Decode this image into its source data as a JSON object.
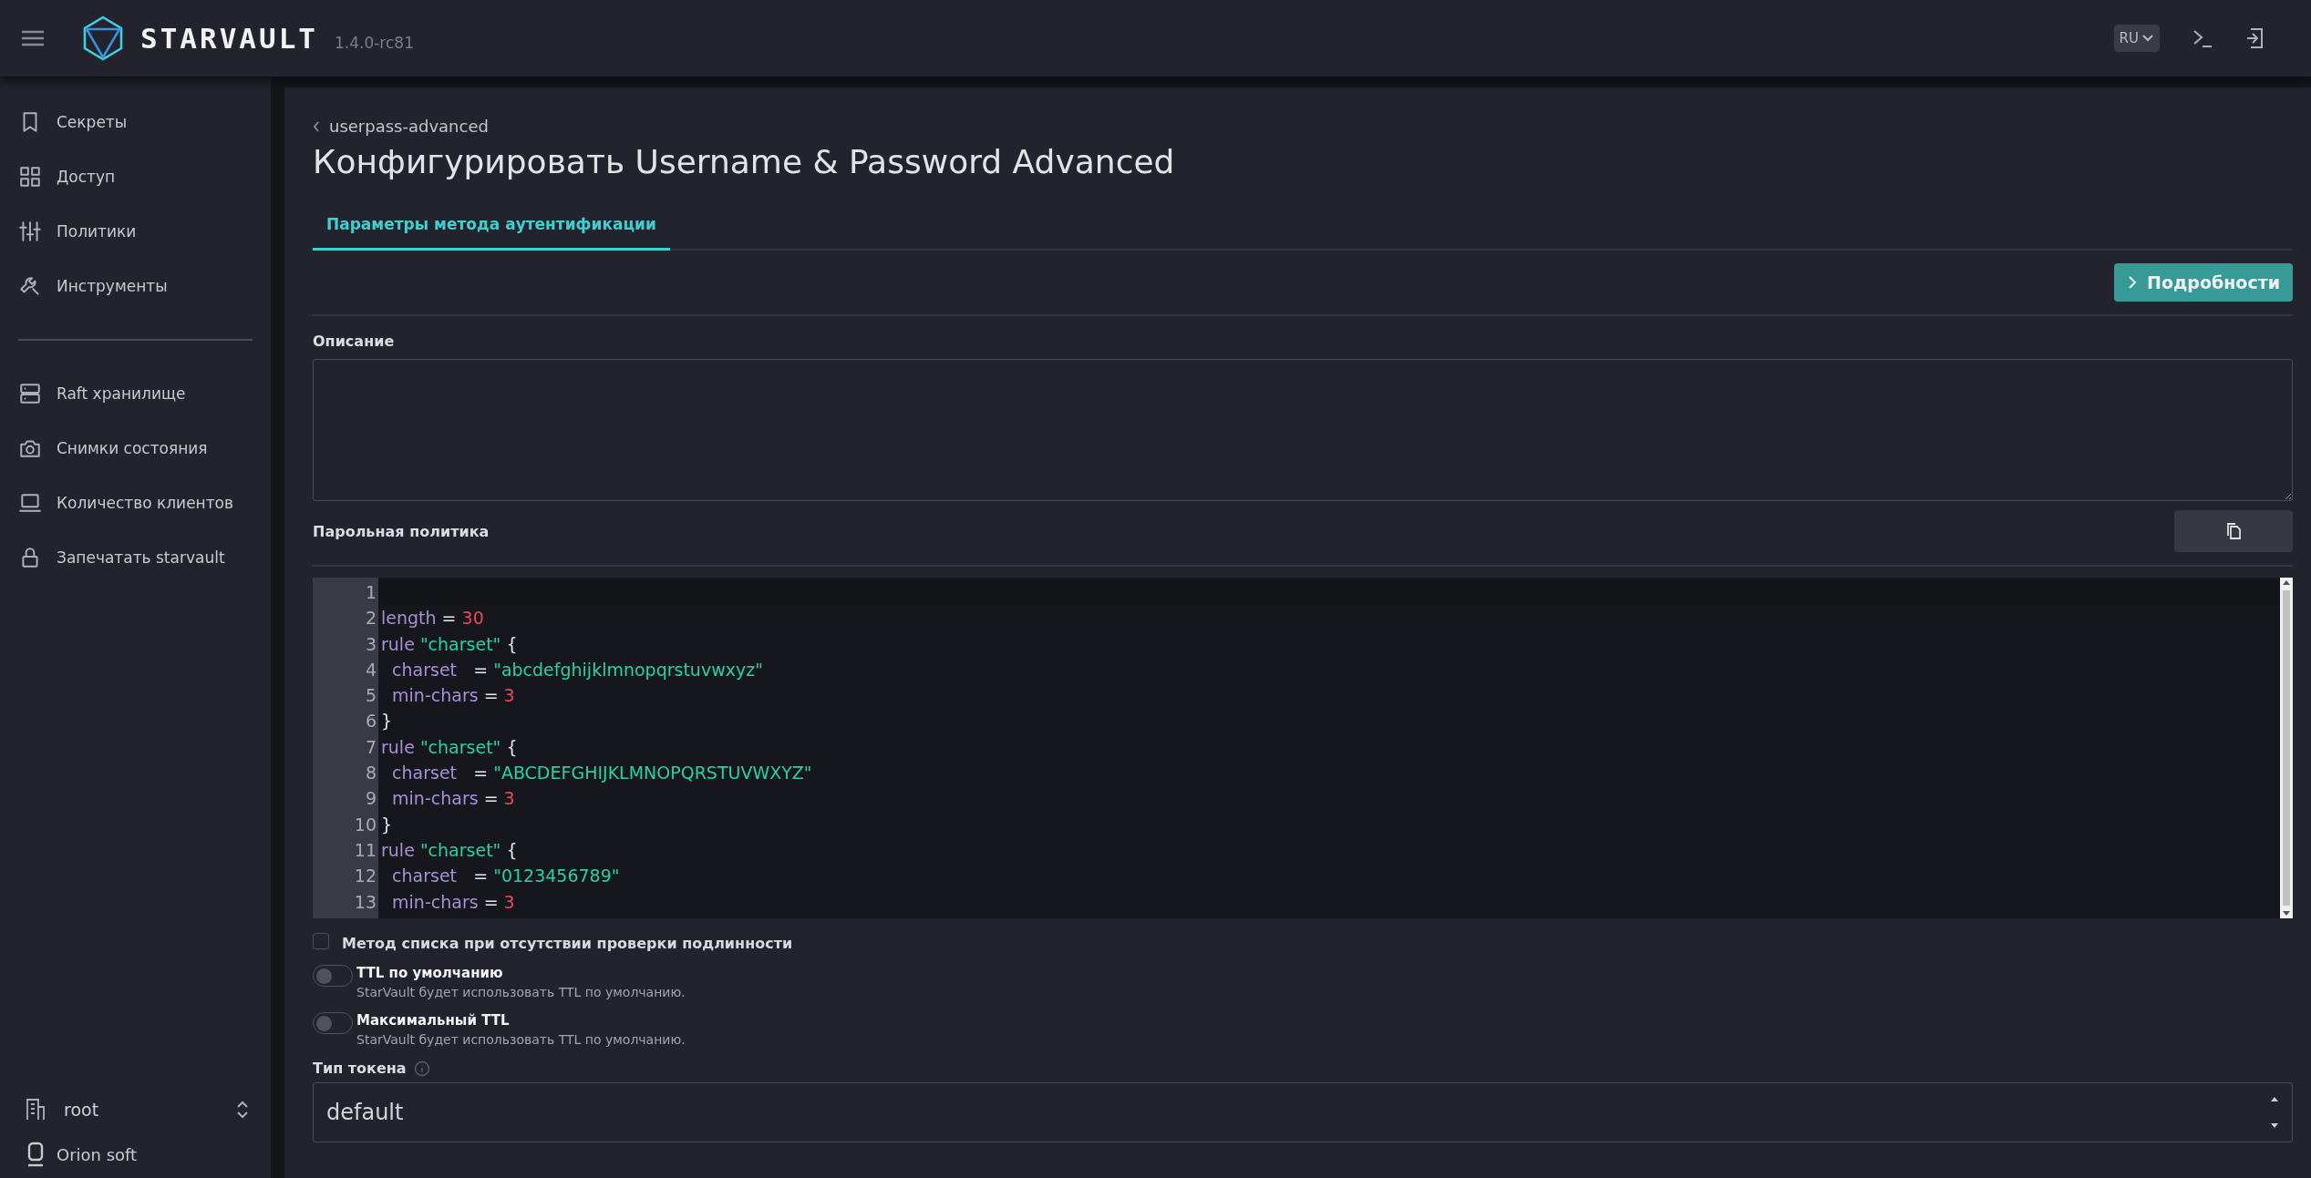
{
  "topbar": {
    "brand": "STARVAULT",
    "version": "1.4.0-rc81",
    "language": "RU"
  },
  "sidebar": {
    "items": [
      {
        "label": "Секреты"
      },
      {
        "label": "Доступ"
      },
      {
        "label": "Политики"
      },
      {
        "label": "Инструменты"
      }
    ],
    "system_items": [
      {
        "label": "Raft хранилище"
      },
      {
        "label": "Снимки состояния"
      },
      {
        "label": "Количество клиентов"
      },
      {
        "label": "Запечатать starvault"
      }
    ],
    "namespace": "root",
    "organization": "Orion soft"
  },
  "breadcrumb": "userpass-advanced",
  "title": "Конфигурировать Username & Password Advanced",
  "tabs": [
    {
      "label": "Параметры метода аутентификации",
      "selected": true
    }
  ],
  "details_button": "Подробности",
  "description": {
    "label": "Описание"
  },
  "password_policy": {
    "label": "Парольная политика",
    "lines": [
      {
        "number": "1"
      },
      {
        "number": "2",
        "tokens": [
          {
            "kind": "key",
            "text": "length"
          },
          {
            "kind": "op",
            "text": " = "
          },
          {
            "kind": "num",
            "text": "30"
          }
        ]
      },
      {
        "number": "3",
        "tokens": [
          {
            "kind": "key",
            "text": "rule "
          },
          {
            "kind": "str",
            "text": "\"charset\""
          },
          {
            "kind": "op",
            "text": " {"
          }
        ]
      },
      {
        "number": "4",
        "tokens": [
          {
            "kind": "key",
            "text": "  charset"
          },
          {
            "kind": "op",
            "text": "   = "
          },
          {
            "kind": "str",
            "text": "\"abcdefghijklmnopqrstuvwxyz\""
          }
        ]
      },
      {
        "number": "5",
        "tokens": [
          {
            "kind": "key",
            "text": "  min-chars"
          },
          {
            "kind": "op",
            "text": " = "
          },
          {
            "kind": "num",
            "text": "3"
          }
        ]
      },
      {
        "number": "6",
        "tokens": [
          {
            "kind": "op",
            "text": "}"
          }
        ]
      },
      {
        "number": "7",
        "tokens": [
          {
            "kind": "key",
            "text": "rule "
          },
          {
            "kind": "str",
            "text": "\"charset\""
          },
          {
            "kind": "op",
            "text": " {"
          }
        ]
      },
      {
        "number": "8",
        "tokens": [
          {
            "kind": "key",
            "text": "  charset"
          },
          {
            "kind": "op",
            "text": "   = "
          },
          {
            "kind": "str",
            "text": "\"ABCDEFGHIJKLMNOPQRSTUVWXYZ\""
          }
        ]
      },
      {
        "number": "9",
        "tokens": [
          {
            "kind": "key",
            "text": "  min-chars"
          },
          {
            "kind": "op",
            "text": " = "
          },
          {
            "kind": "num",
            "text": "3"
          }
        ]
      },
      {
        "number": "10",
        "tokens": [
          {
            "kind": "op",
            "text": "}"
          }
        ]
      },
      {
        "number": "11",
        "tokens": [
          {
            "kind": "key",
            "text": "rule "
          },
          {
            "kind": "str",
            "text": "\"charset\""
          },
          {
            "kind": "op",
            "text": " {"
          }
        ]
      },
      {
        "number": "12",
        "tokens": [
          {
            "kind": "key",
            "text": "  charset"
          },
          {
            "kind": "op",
            "text": "   = "
          },
          {
            "kind": "str",
            "text": "\"0123456789\""
          }
        ]
      },
      {
        "number": "13",
        "tokens": [
          {
            "kind": "key",
            "text": "  min-chars"
          },
          {
            "kind": "op",
            "text": " = "
          },
          {
            "kind": "num",
            "text": "3"
          }
        ]
      }
    ]
  },
  "options": [
    {
      "kind": "checkbox",
      "label": "Метод списка при отсутствии проверки подлинности",
      "checked": false
    },
    {
      "kind": "toggle",
      "label": "TTL по умолчанию",
      "hint": "StarVault будет использовать TTL по умолчанию.",
      "on": false
    },
    {
      "kind": "toggle",
      "label": "Максимальный TTL",
      "hint": "StarVault будет использовать TTL по умолчанию.",
      "on": false
    }
  ],
  "token_type": {
    "label": "Тип токена",
    "value": "default"
  }
}
